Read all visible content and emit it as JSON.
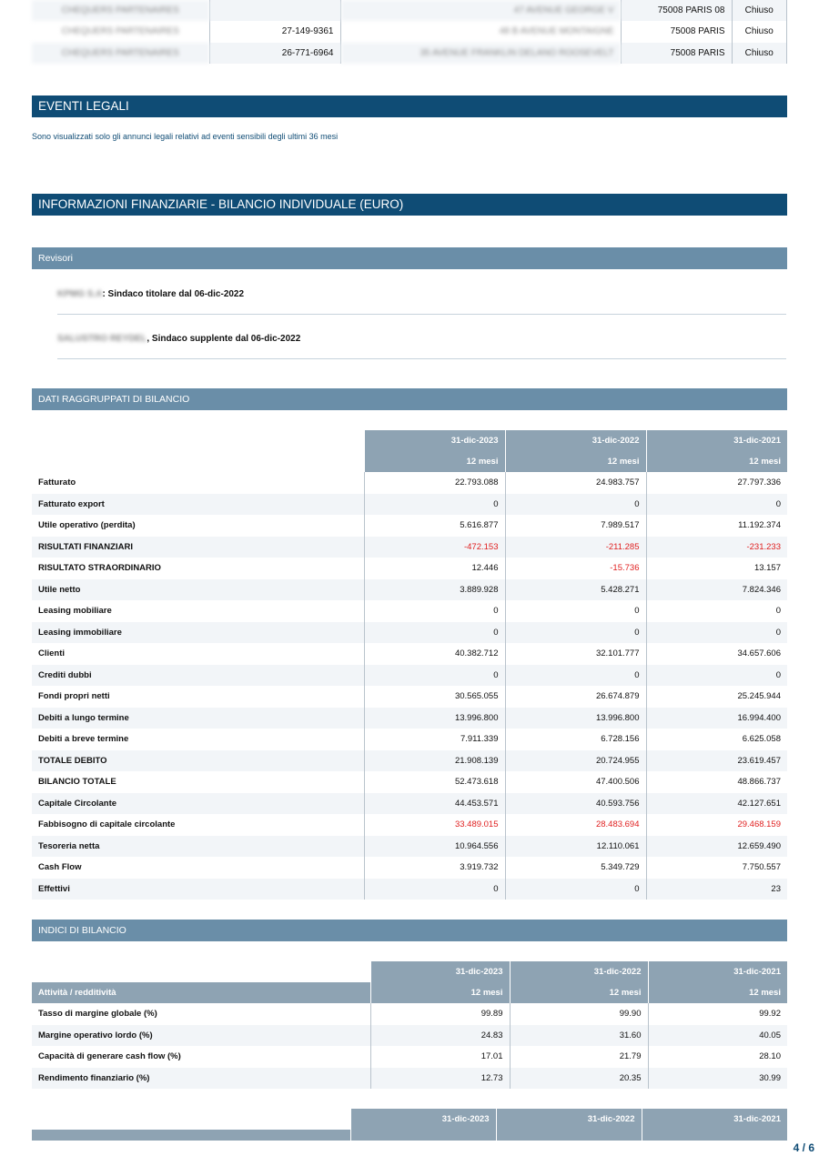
{
  "establishments": [
    {
      "name": "CHEQUERS PARTENAIRES",
      "phone": "",
      "address": "47 AVENUE GEORGE V",
      "city": "75008 PARIS 08",
      "status": "Chiuso"
    },
    {
      "name": "CHEQUERS PARTENAIRES",
      "phone": "27-149-9361",
      "address": "48 B AVENUE MONTAIGNE",
      "city": "75008 PARIS",
      "status": "Chiuso"
    },
    {
      "name": "CHEQUERS PARTENAIRES",
      "phone": "26-771-6964",
      "address": "35 AVENUE FRANKLIN DELANO ROOSEVELT",
      "city": "75008 PARIS",
      "status": "Chiuso"
    }
  ],
  "legal_events": {
    "title": "EVENTI LEGALI",
    "note": "Sono visualizzati solo gli annunci legali relativi ad eventi sensibili degli ultimi 36 mesi"
  },
  "financial": {
    "title": "INFORMAZIONI FINANZIARIE - BILANCIO INDIVIDUALE (EURO)",
    "auditors_title": "Revisori",
    "auditors": [
      {
        "name": "KPMG S.A",
        "role": ": Sindaco titolare dal 06-dic-2022"
      },
      {
        "name": "SALUSTRO REYDEL",
        "role": ", Sindaco supplente dal 06-dic-2022"
      }
    ],
    "grouped_title": "DATI RAGGRUPPATI DI BILANCIO",
    "dates": [
      "31-dic-2023",
      "31-dic-2022",
      "31-dic-2021"
    ],
    "periods": [
      "12 mesi",
      "12 mesi",
      "12 mesi"
    ],
    "rows": [
      {
        "label": "Fatturato",
        "v": [
          "22.793.088",
          "24.983.757",
          "27.797.336"
        ],
        "neg": [
          false,
          false,
          false
        ]
      },
      {
        "label": "Fatturato export",
        "v": [
          "0",
          "0",
          "0"
        ],
        "neg": [
          false,
          false,
          false
        ]
      },
      {
        "label": "Utile operativo (perdita)",
        "v": [
          "5.616.877",
          "7.989.517",
          "11.192.374"
        ],
        "neg": [
          false,
          false,
          false
        ]
      },
      {
        "label": "RISULTATI FINANZIARI",
        "v": [
          "-472.153",
          "-211.285",
          "-231.233"
        ],
        "neg": [
          true,
          true,
          true
        ]
      },
      {
        "label": "RISULTATO STRAORDINARIO",
        "v": [
          "12.446",
          "-15.736",
          "13.157"
        ],
        "neg": [
          false,
          true,
          false
        ]
      },
      {
        "label": "Utile netto",
        "v": [
          "3.889.928",
          "5.428.271",
          "7.824.346"
        ],
        "neg": [
          false,
          false,
          false
        ]
      },
      {
        "label": "Leasing mobiliare",
        "v": [
          "0",
          "0",
          "0"
        ],
        "neg": [
          false,
          false,
          false
        ]
      },
      {
        "label": "Leasing immobiliare",
        "v": [
          "0",
          "0",
          "0"
        ],
        "neg": [
          false,
          false,
          false
        ]
      },
      {
        "label": "Clienti",
        "v": [
          "40.382.712",
          "32.101.777",
          "34.657.606"
        ],
        "neg": [
          false,
          false,
          false
        ]
      },
      {
        "label": "Crediti dubbi",
        "v": [
          "0",
          "0",
          "0"
        ],
        "neg": [
          false,
          false,
          false
        ]
      },
      {
        "label": "Fondi propri netti",
        "v": [
          "30.565.055",
          "26.674.879",
          "25.245.944"
        ],
        "neg": [
          false,
          false,
          false
        ]
      },
      {
        "label": "Debiti a lungo termine",
        "v": [
          "13.996.800",
          "13.996.800",
          "16.994.400"
        ],
        "neg": [
          false,
          false,
          false
        ]
      },
      {
        "label": "Debiti a breve termine",
        "v": [
          "7.911.339",
          "6.728.156",
          "6.625.058"
        ],
        "neg": [
          false,
          false,
          false
        ]
      },
      {
        "label": "TOTALE DEBITO",
        "v": [
          "21.908.139",
          "20.724.955",
          "23.619.457"
        ],
        "neg": [
          false,
          false,
          false
        ]
      },
      {
        "label": "BILANCIO TOTALE",
        "v": [
          "52.473.618",
          "47.400.506",
          "48.866.737"
        ],
        "neg": [
          false,
          false,
          false
        ]
      },
      {
        "label": "Capitale Circolante",
        "v": [
          "44.453.571",
          "40.593.756",
          "42.127.651"
        ],
        "neg": [
          false,
          false,
          false
        ]
      },
      {
        "label": "Fabbisogno di capitale circolante",
        "v": [
          "33.489.015",
          "28.483.694",
          "29.468.159"
        ],
        "neg": [
          true,
          true,
          true
        ]
      },
      {
        "label": "Tesoreria netta",
        "v": [
          "10.964.556",
          "12.110.061",
          "12.659.490"
        ],
        "neg": [
          false,
          false,
          false
        ]
      },
      {
        "label": "Cash Flow",
        "v": [
          "3.919.732",
          "5.349.729",
          "7.750.557"
        ],
        "neg": [
          false,
          false,
          false
        ]
      },
      {
        "label": "Effettivi",
        "v": [
          "0",
          "0",
          "23"
        ],
        "neg": [
          false,
          false,
          false
        ]
      }
    ],
    "ratios_title": "INDICI DI BILANCIO",
    "ratios_group_label": "Attività / redditività",
    "ratios": [
      {
        "label": "Tasso di margine globale (%)",
        "v": [
          "99.89",
          "99.90",
          "99.92"
        ]
      },
      {
        "label": "Margine operativo lordo (%)",
        "v": [
          "24.83",
          "31.60",
          "40.05"
        ]
      },
      {
        "label": "Capacità di generare cash flow (%)",
        "v": [
          "17.01",
          "21.79",
          "28.10"
        ]
      },
      {
        "label": "Rendimento finanziario (%)",
        "v": [
          "12.73",
          "20.35",
          "30.99"
        ]
      }
    ]
  },
  "page": "4 / 6"
}
